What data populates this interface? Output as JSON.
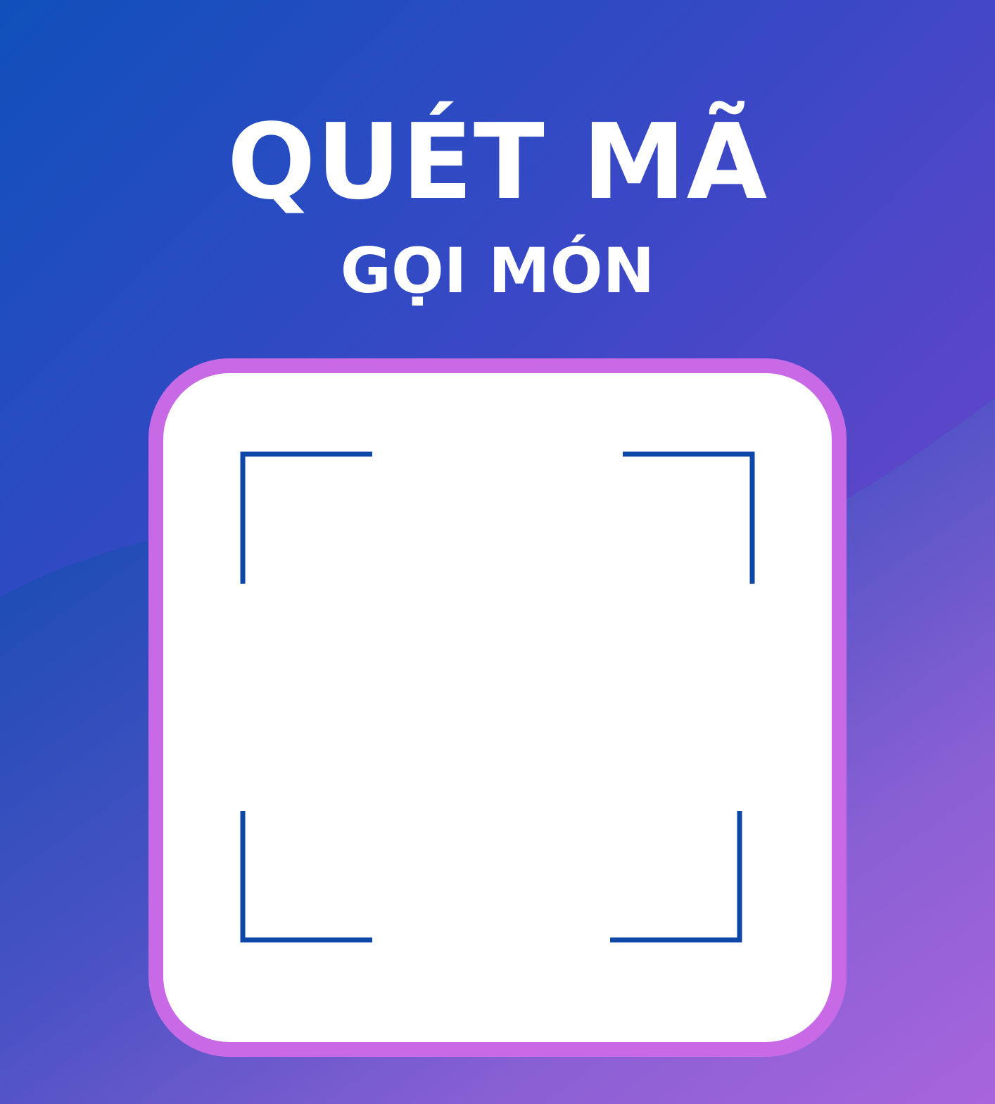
{
  "poster": {
    "title_line1": "QUÉT MÃ",
    "title_line2": "GỌI MÓN"
  },
  "colors": {
    "background_start": "#1050bb",
    "background_end": "#7a3fcc",
    "card_border": "#c86ae6",
    "card_fill": "#ffffff",
    "scan_corners": "#0d47a8",
    "title_text": "#ffffff"
  },
  "icons": {
    "scan_frame": "qr-scan-frame-icon"
  }
}
